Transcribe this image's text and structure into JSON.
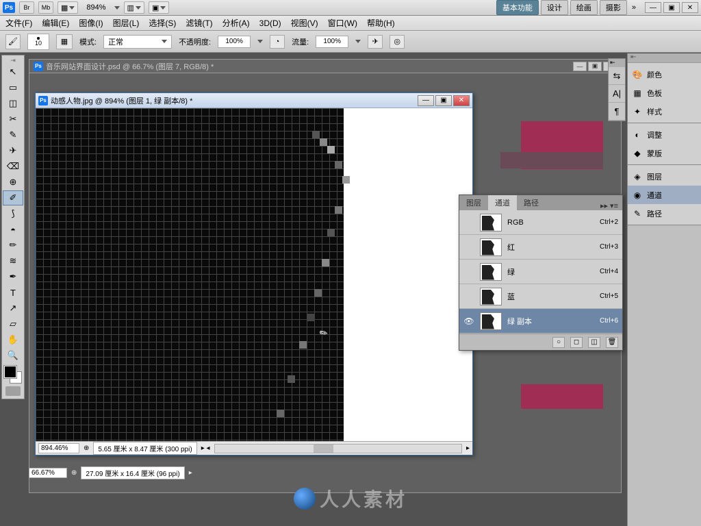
{
  "app_bar": {
    "logo": "Ps",
    "br": "Br",
    "mb": "Mb",
    "zoom": "894%",
    "workspaces": [
      "基本功能",
      "设计",
      "绘画",
      "摄影"
    ],
    "more": "»"
  },
  "menu": {
    "file": "文件(F)",
    "edit": "编辑(E)",
    "image": "图像(I)",
    "layer": "图层(L)",
    "select": "选择(S)",
    "filter": "滤镜(T)",
    "analysis": "分析(A)",
    "three_d": "3D(D)",
    "view": "视图(V)",
    "window": "窗口(W)",
    "help": "帮助(H)"
  },
  "options": {
    "brush_size": "10",
    "mode_label": "模式:",
    "mode_value": "正常",
    "opacity_label": "不透明度:",
    "opacity_value": "100%",
    "flow_label": "流量:",
    "flow_value": "100%"
  },
  "outer_doc": {
    "title": "音乐网站界面设计.psd @ 66.7% (图层 7, RGB/8) *",
    "zoom": "66.67%",
    "dims": "27.09 厘米 x 16.4 厘米 (96 ppi)"
  },
  "inner_doc": {
    "title": "动感人物.jpg @ 894% (图层 1, 绿 副本/8) *",
    "zoom": "894.46%",
    "dims": "5.65 厘米 x 8.47 厘米 (300 ppi)"
  },
  "channels_panel": {
    "tabs": [
      "图层",
      "通道",
      "路径"
    ],
    "active_tab": 1,
    "channels": [
      {
        "name": "RGB",
        "key": "Ctrl+2",
        "visible": false
      },
      {
        "name": "红",
        "key": "Ctrl+3",
        "visible": false
      },
      {
        "name": "绿",
        "key": "Ctrl+4",
        "visible": false
      },
      {
        "name": "蓝",
        "key": "Ctrl+5",
        "visible": false
      },
      {
        "name": "绿 副本",
        "key": "Ctrl+6",
        "visible": true,
        "selected": true
      }
    ]
  },
  "right_panels": {
    "group1": [
      {
        "icon": "🎨",
        "label": "颜色"
      },
      {
        "icon": "▦",
        "label": "色板"
      },
      {
        "icon": "✦",
        "label": "样式"
      }
    ],
    "group2": [
      {
        "icon": "◐",
        "label": "调整"
      },
      {
        "icon": "◆",
        "label": "蒙版"
      }
    ],
    "group3": [
      {
        "icon": "◈",
        "label": "图层"
      },
      {
        "icon": "◉",
        "label": "通道",
        "active": true
      },
      {
        "icon": "✎",
        "label": "路径"
      }
    ]
  },
  "inner_strip": [
    "⇆",
    "A|",
    "¶"
  ],
  "tools": [
    "↖",
    "▭",
    "◫",
    "✂",
    "✎",
    "✈",
    "⌫",
    "⊕",
    "✐",
    "⟆",
    "◓",
    "✏",
    "≋",
    "✒",
    "T",
    "↗",
    "▱",
    "✋",
    "🔍"
  ],
  "watermark": "人人素材"
}
